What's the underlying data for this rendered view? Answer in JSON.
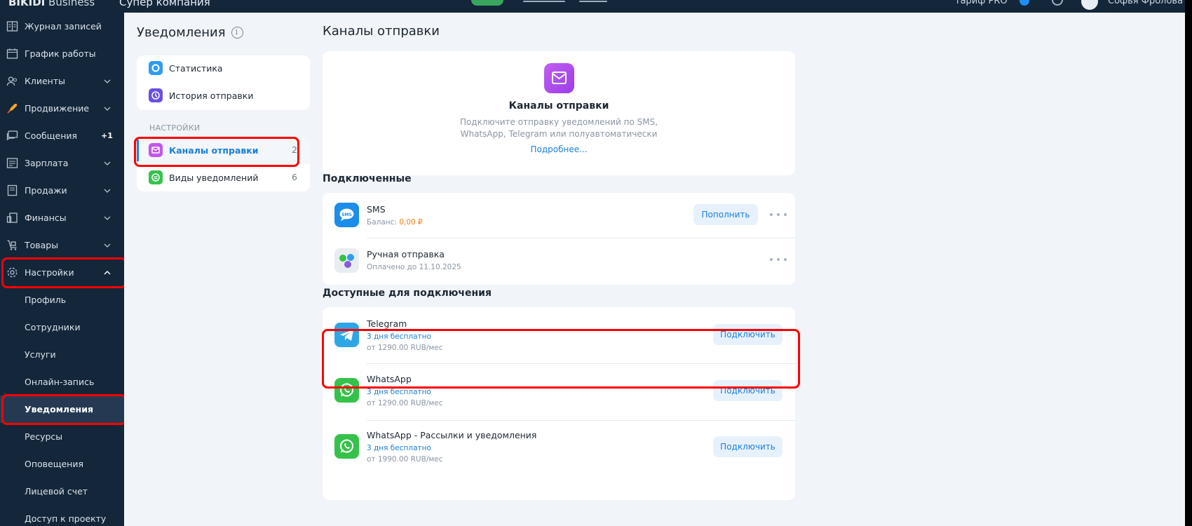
{
  "topbar": {
    "brand_bold": "BIKIDI",
    "brand_light": "Business",
    "company": "Супер компания",
    "tariff": "тариф PRO",
    "user": "Софья Фролова"
  },
  "sidebar": {
    "items": [
      {
        "label": "Журнал записей",
        "icon": "journal-icon"
      },
      {
        "label": "График работы",
        "icon": "calendar-icon"
      },
      {
        "label": "Клиенты",
        "icon": "clients-icon"
      },
      {
        "label": "Продвижение",
        "icon": "rocket-icon"
      },
      {
        "label": "Сообщения",
        "icon": "messages-icon",
        "badge": "+1"
      },
      {
        "label": "Зарплата",
        "icon": "salary-icon"
      },
      {
        "label": "Продажи",
        "icon": "sales-icon"
      },
      {
        "label": "Финансы",
        "icon": "finance-icon"
      },
      {
        "label": "Товары",
        "icon": "goods-icon"
      },
      {
        "label": "Настройки",
        "icon": "gear-icon"
      }
    ],
    "subitems": [
      {
        "label": "Профиль"
      },
      {
        "label": "Сотрудники"
      },
      {
        "label": "Услуги"
      },
      {
        "label": "Онлайн-запись"
      },
      {
        "label": "Уведомления"
      },
      {
        "label": "Ресурсы"
      },
      {
        "label": "Оповещения"
      },
      {
        "label": "Лицевой счет"
      },
      {
        "label": "Доступ к проекту"
      }
    ]
  },
  "menu": {
    "title": "Уведомления",
    "top_items": [
      {
        "label": "Статистика",
        "color": "#2f9cf0"
      },
      {
        "label": "История отправки",
        "color": "#6b4fe0"
      }
    ],
    "section": "НАСТРОЙКИ",
    "settings_items": [
      {
        "label": "Каналы отправки",
        "count": "2",
        "color": "#c257ea"
      },
      {
        "label": "Виды уведомлений",
        "count": "6",
        "color": "#36c24a"
      }
    ]
  },
  "main": {
    "title": "Каналы отправки",
    "hero": {
      "title": "Каналы отправки",
      "desc_line1": "Подключите отправку уведомлений по SMS,",
      "desc_line2": "WhatsApp, Telegram или полуавтоматически",
      "link": "Подробнее..."
    },
    "connected_title": "Подключенные",
    "connected": [
      {
        "name": "SMS",
        "sub_prefix": "Баланс:",
        "sub_value": "0,00 ₽",
        "button": "Пополнить",
        "icon": "sms-icon"
      },
      {
        "name": "Ручная отправка",
        "sub": "Оплачено до 11.10.2025",
        "icon": "manual-send-icon"
      }
    ],
    "available_title": "Доступные для подключения",
    "available": [
      {
        "name": "Telegram",
        "trial": "3 дня бесплатно",
        "price": "от 1290.00 RUB/мес",
        "button": "Подключить",
        "icon": "telegram-icon"
      },
      {
        "name": "WhatsApp",
        "trial": "3 дня бесплатно",
        "price": "от 1290.00 RUB/мес",
        "button": "Подключить",
        "icon": "whatsapp-icon"
      },
      {
        "name": "WhatsApp - Рассылки и уведомления",
        "trial": "3 дня бесплатно",
        "price": "от 1990.00 RUB/мес",
        "button": "Подключить",
        "icon": "whatsapp-icon"
      }
    ]
  },
  "colors": {
    "sidebar_bg": "#13263a",
    "accent": "#1a7fdc",
    "highlight": "#ff0000",
    "balance": "#f07f14"
  }
}
